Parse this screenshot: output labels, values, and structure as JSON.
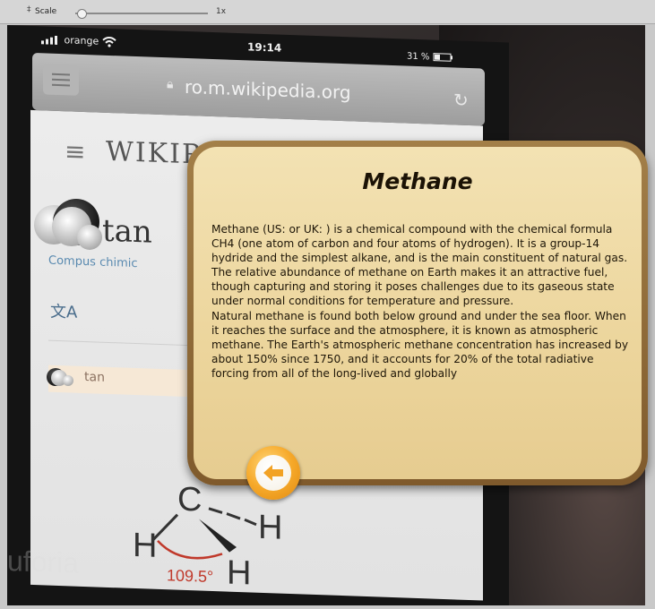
{
  "toolbar": {
    "grip": "‡",
    "scale_label": "Scale",
    "scale_value": "1x",
    "scale_fraction": 0.0
  },
  "phone": {
    "carrier": "orange",
    "time": "19:14",
    "battery": "31 %",
    "url": "ro.m.wikipedia.org",
    "site_title": "WIKIPE",
    "article_title": "tan",
    "description": "Compus chimic",
    "toc_label": "tan"
  },
  "structure": {
    "carbon": "C",
    "h_top": "H",
    "h_left": "H",
    "h_bottom": "H",
    "angle": "109.5°"
  },
  "watermark": "uforia",
  "card": {
    "title": "Methane",
    "body": "Methane (US:  or UK: ) is a chemical compound with the chemical formula CH4 (one atom of carbon and four atoms of hydrogen). It is a group-14 hydride and the simplest alkane, and is the main constituent of natural gas. The relative abundance of methane on Earth makes it an attractive fuel, though capturing and storing it poses challenges due to its gaseous state under normal conditions for temperature and pressure.\nNatural methane is found both below ground and under the sea floor. When it reaches the surface and the atmosphere, it is known as atmospheric methane. The Earth's atmospheric methane concentration has increased by about 150% since 1750, and it accounts for 20% of the total radiative forcing from all of the long-lived and globally"
  },
  "colors": {
    "card_fill": "#ecd59c",
    "card_border": "#8f6a36",
    "button_orange": "#f6a92a",
    "angle_red": "#c0392b"
  },
  "icons": {
    "back": "arrow-left-icon",
    "lock": "lock-icon",
    "reload": "reload-icon",
    "menu": "hamburger-icon",
    "translate": "translate-icon"
  }
}
